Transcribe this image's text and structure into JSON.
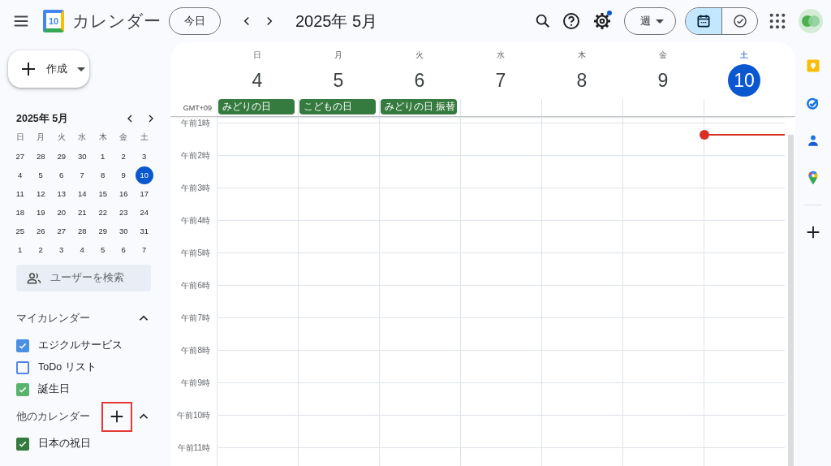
{
  "header": {
    "app_name": "カレンダー",
    "logo_date": "10",
    "today_button": "今日",
    "period_title": "2025年 5月",
    "settings_badge": true,
    "view_menu": "週",
    "view_toggle": [
      {
        "kind": "calendar",
        "selected": true
      },
      {
        "kind": "tasks",
        "selected": false
      }
    ]
  },
  "sidebar": {
    "create_button": "作成",
    "mini_calendar": {
      "title": "2025年 5月",
      "weekdays": [
        "日",
        "月",
        "火",
        "水",
        "木",
        "金",
        "土"
      ],
      "weeks": [
        [
          {
            "day": "27",
            "selected": false
          },
          {
            "day": "28",
            "selected": false
          },
          {
            "day": "29",
            "selected": false
          },
          {
            "day": "30",
            "selected": false
          },
          {
            "day": "1",
            "selected": false
          },
          {
            "day": "2",
            "selected": false
          },
          {
            "day": "3",
            "selected": false
          }
        ],
        [
          {
            "day": "4",
            "selected": false
          },
          {
            "day": "5",
            "selected": false
          },
          {
            "day": "6",
            "selected": false
          },
          {
            "day": "7",
            "selected": false
          },
          {
            "day": "8",
            "selected": false
          },
          {
            "day": "9",
            "selected": false
          },
          {
            "day": "10",
            "selected": true
          }
        ],
        [
          {
            "day": "11",
            "selected": false
          },
          {
            "day": "12",
            "selected": false
          },
          {
            "day": "13",
            "selected": false
          },
          {
            "day": "14",
            "selected": false
          },
          {
            "day": "15",
            "selected": false
          },
          {
            "day": "16",
            "selected": false
          },
          {
            "day": "17",
            "selected": false
          }
        ],
        [
          {
            "day": "18",
            "selected": false
          },
          {
            "day": "19",
            "selected": false
          },
          {
            "day": "20",
            "selected": false
          },
          {
            "day": "21",
            "selected": false
          },
          {
            "day": "22",
            "selected": false
          },
          {
            "day": "23",
            "selected": false
          },
          {
            "day": "24",
            "selected": false
          }
        ],
        [
          {
            "day": "25",
            "selected": false
          },
          {
            "day": "26",
            "selected": false
          },
          {
            "day": "27",
            "selected": false
          },
          {
            "day": "28",
            "selected": false
          },
          {
            "day": "29",
            "selected": false
          },
          {
            "day": "30",
            "selected": false
          },
          {
            "day": "31",
            "selected": false
          }
        ],
        [
          {
            "day": "1",
            "selected": false
          },
          {
            "day": "2",
            "selected": false
          },
          {
            "day": "3",
            "selected": false
          },
          {
            "day": "4",
            "selected": false
          },
          {
            "day": "5",
            "selected": false
          },
          {
            "day": "6",
            "selected": false
          },
          {
            "day": "7",
            "selected": false
          }
        ]
      ]
    },
    "people_search": {
      "placeholder": "ユーザーを検索"
    },
    "calendar_groups": [
      {
        "title": "マイカレンダー",
        "expanded": true,
        "items": [
          {
            "label": "エジクルサービス",
            "checked": true,
            "color": "#4a90e2"
          },
          {
            "label": "ToDo リスト",
            "checked": false,
            "color": "#5484ed"
          },
          {
            "label": "誕生日",
            "checked": true,
            "color": "#57b36d"
          }
        ]
      },
      {
        "title": "他のカレンダー",
        "expanded": true,
        "add_button": {
          "highlighted": true
        },
        "items": [
          {
            "label": "日本の祝日",
            "checked": true,
            "color": "#357a3f"
          }
        ]
      }
    ]
  },
  "week": {
    "timezone": "GMT+09",
    "now_indicator": true,
    "days": [
      {
        "weekday": "日",
        "date": "4",
        "today": false,
        "all_day": [
          {
            "title": "みどりの日"
          }
        ]
      },
      {
        "weekday": "月",
        "date": "5",
        "today": false,
        "all_day": [
          {
            "title": "こどもの日"
          }
        ]
      },
      {
        "weekday": "火",
        "date": "6",
        "today": false,
        "all_day": [
          {
            "title": "みどりの日 振替"
          }
        ]
      },
      {
        "weekday": "水",
        "date": "7",
        "today": false
      },
      {
        "weekday": "木",
        "date": "8",
        "today": false
      },
      {
        "weekday": "金",
        "date": "9",
        "today": false
      },
      {
        "weekday": "土",
        "date": "10",
        "today": true
      }
    ],
    "hours": [
      "午前1時",
      "午前2時",
      "午前3時",
      "午前4時",
      "午前5時",
      "午前6時",
      "午前7時",
      "午前8時",
      "午前9時",
      "午前10時",
      "午前11時"
    ]
  }
}
